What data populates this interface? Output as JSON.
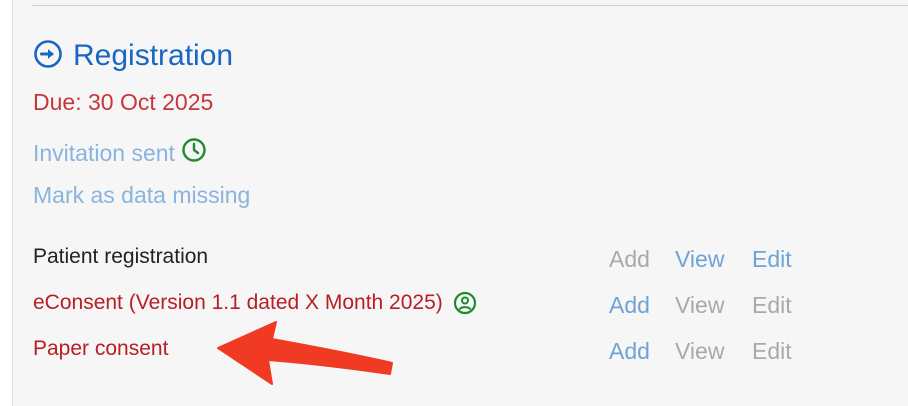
{
  "section": {
    "title": "Registration",
    "icon": "arrow-right-circle-icon",
    "due": "Due: 30 Oct 2025",
    "invitation": "Invitation sent",
    "invitation_icon": "clock-icon",
    "mark_missing": "Mark as data missing"
  },
  "rows": [
    {
      "label": "Patient registration",
      "add": "Add",
      "view": "View",
      "edit": "Edit"
    },
    {
      "label": "eConsent (Version 1.1 dated X Month 2025)",
      "icon": "user-circle-icon",
      "add": "Add",
      "view": "View",
      "edit": "Edit"
    },
    {
      "label": "Paper consent",
      "add": "Add",
      "view": "View",
      "edit": "Edit"
    }
  ],
  "colors": {
    "title_blue": "#1a66c2",
    "due_red": "#c8363b",
    "link_light_blue": "#8ab4dd",
    "consent_red": "#b81e23",
    "disabled_gray": "#a9a9a9",
    "icon_green": "#1e8a2e",
    "annotation_arrow": "#f03a24"
  }
}
